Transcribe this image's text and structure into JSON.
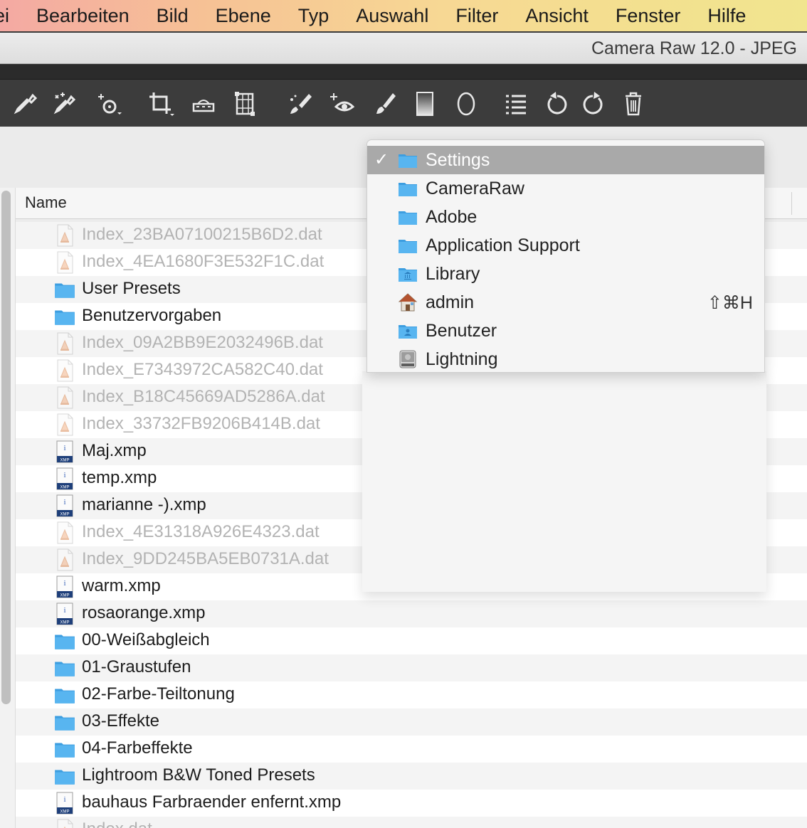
{
  "menubar": {
    "items": [
      "ei",
      "Bearbeiten",
      "Bild",
      "Ebene",
      "Typ",
      "Auswahl",
      "Filter",
      "Ansicht",
      "Fenster",
      "Hilfe"
    ]
  },
  "window": {
    "title": "Camera Raw 12.0 - JPEG"
  },
  "toolbar": {
    "tools": [
      {
        "icon": "eyedropper-icon"
      },
      {
        "icon": "color-sampler-icon"
      },
      {
        "icon": "targeted-adjustment-icon"
      },
      {
        "icon": "crop-icon"
      },
      {
        "icon": "straighten-icon"
      },
      {
        "icon": "transform-icon"
      },
      {
        "icon": "spot-removal-icon"
      },
      {
        "icon": "red-eye-icon"
      },
      {
        "icon": "adjustment-brush-icon"
      },
      {
        "icon": "graduated-filter-icon"
      },
      {
        "icon": "radial-filter-icon"
      },
      {
        "icon": "preferences-list-icon"
      },
      {
        "icon": "rotate-left-icon"
      },
      {
        "icon": "rotate-right-icon"
      },
      {
        "icon": "trash-icon"
      }
    ]
  },
  "list": {
    "column_name": "Name",
    "files": [
      {
        "name": "Index_23BA07100215B6D2.dat",
        "type": "dat",
        "dim": true
      },
      {
        "name": "Index_4EA1680F3E532F1C.dat",
        "type": "dat",
        "dim": true
      },
      {
        "name": "User Presets",
        "type": "folder",
        "dim": false
      },
      {
        "name": "Benutzervorgaben",
        "type": "folder",
        "dim": false
      },
      {
        "name": "Index_09A2BB9E2032496B.dat",
        "type": "dat",
        "dim": true
      },
      {
        "name": "Index_E7343972CA582C40.dat",
        "type": "dat",
        "dim": true
      },
      {
        "name": "Index_B18C45669AD5286A.dat",
        "type": "dat",
        "dim": true
      },
      {
        "name": "Index_33732FB9206B414B.dat",
        "type": "dat",
        "dim": true
      },
      {
        "name": "Maj.xmp",
        "type": "xmp",
        "dim": false
      },
      {
        "name": "temp.xmp",
        "type": "xmp",
        "dim": false
      },
      {
        "name": "marianne -).xmp",
        "type": "xmp",
        "dim": false
      },
      {
        "name": "Index_4E31318A926E4323.dat",
        "type": "dat",
        "dim": true
      },
      {
        "name": "Index_9DD245BA5EB0731A.dat",
        "type": "dat",
        "dim": true
      },
      {
        "name": "warm.xmp",
        "type": "xmp",
        "dim": false
      },
      {
        "name": "rosaorange.xmp",
        "type": "xmp",
        "dim": false
      },
      {
        "name": "00-Weißabgleich",
        "type": "folder",
        "dim": false
      },
      {
        "name": "01-Graustufen",
        "type": "folder",
        "dim": false
      },
      {
        "name": "02-Farbe-Teiltonung",
        "type": "folder",
        "dim": false
      },
      {
        "name": "03-Effekte",
        "type": "folder",
        "dim": false
      },
      {
        "name": "04-Farbeffekte",
        "type": "folder",
        "dim": false
      },
      {
        "name": "Lightroom B&W Toned Presets",
        "type": "folder",
        "dim": false
      },
      {
        "name": "bauhaus Farbraender enfernt.xmp",
        "type": "xmp",
        "dim": false
      },
      {
        "name": "Index.dat",
        "type": "dat",
        "dim": true
      }
    ]
  },
  "popup": {
    "items": [
      {
        "label": "Settings",
        "icon": "folder-icon",
        "selected": true,
        "check": "✓",
        "shortcut": ""
      },
      {
        "label": "CameraRaw",
        "icon": "folder-icon",
        "selected": false,
        "check": "",
        "shortcut": ""
      },
      {
        "label": "Adobe",
        "icon": "folder-icon",
        "selected": false,
        "check": "",
        "shortcut": ""
      },
      {
        "label": "Application Support",
        "icon": "folder-icon",
        "selected": false,
        "check": "",
        "shortcut": ""
      },
      {
        "label": "Library",
        "icon": "library-folder-icon",
        "selected": false,
        "check": "",
        "shortcut": ""
      },
      {
        "label": "admin",
        "icon": "home-icon",
        "selected": false,
        "check": "",
        "shortcut": "⇧⌘H"
      },
      {
        "label": "Benutzer",
        "icon": "users-folder-icon",
        "selected": false,
        "check": "",
        "shortcut": ""
      },
      {
        "label": "Lightning",
        "icon": "hard-drive-icon",
        "selected": false,
        "check": "",
        "shortcut": ""
      }
    ]
  },
  "colors": {
    "folder": "#58b5f0",
    "selection": "#a9a9a9",
    "toolbar": "#3c3c3c"
  }
}
